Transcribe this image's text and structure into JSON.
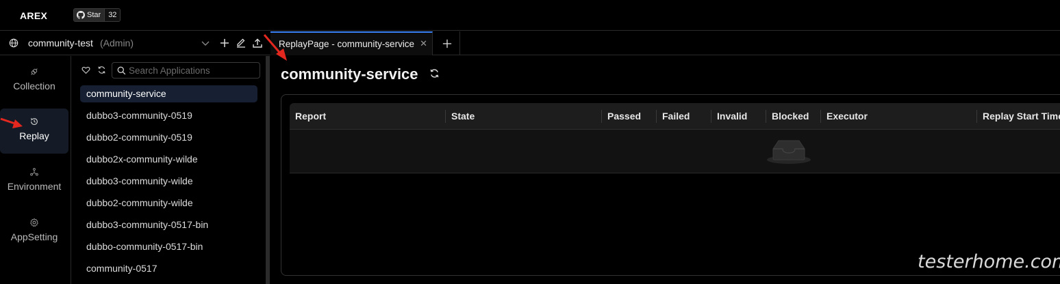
{
  "app": {
    "brand": "AREX",
    "github": {
      "star_label": "Star",
      "count": "32"
    }
  },
  "workspace": {
    "name": "community-test",
    "role": "(Admin)"
  },
  "tabs": [
    {
      "label": "ReplayPage - community-service",
      "active": true
    }
  ],
  "nav": {
    "items": [
      {
        "label": "Collection",
        "icon": "collection-icon"
      },
      {
        "label": "Replay",
        "icon": "replay-icon",
        "active": true
      },
      {
        "label": "Environment",
        "icon": "environment-icon"
      },
      {
        "label": "AppSetting",
        "icon": "gear-icon"
      }
    ]
  },
  "apps": {
    "search_placeholder": "Search Applications",
    "items": [
      {
        "label": "community-service",
        "active": true
      },
      {
        "label": "dubbo3-community-0519"
      },
      {
        "label": "dubbo2-community-0519"
      },
      {
        "label": "dubbo2x-community-wilde"
      },
      {
        "label": "dubbo3-community-wilde"
      },
      {
        "label": "dubbo2-community-wilde"
      },
      {
        "label": "dubbo3-community-0517-bin"
      },
      {
        "label": "dubbo-community-0517-bin"
      },
      {
        "label": "community-0517"
      }
    ]
  },
  "main": {
    "title": "community-service",
    "table": {
      "columns": [
        "Report",
        "State",
        "Passed",
        "Failed",
        "Invalid",
        "Blocked",
        "Executor",
        "Replay Start Time"
      ],
      "rows": []
    }
  },
  "watermark": "testerhome.com",
  "colors": {
    "accent": "#3b82f6",
    "active_nav_bg": "#141b26",
    "active_app_bg": "#162032",
    "annotation_arrow": "#e5281f"
  }
}
